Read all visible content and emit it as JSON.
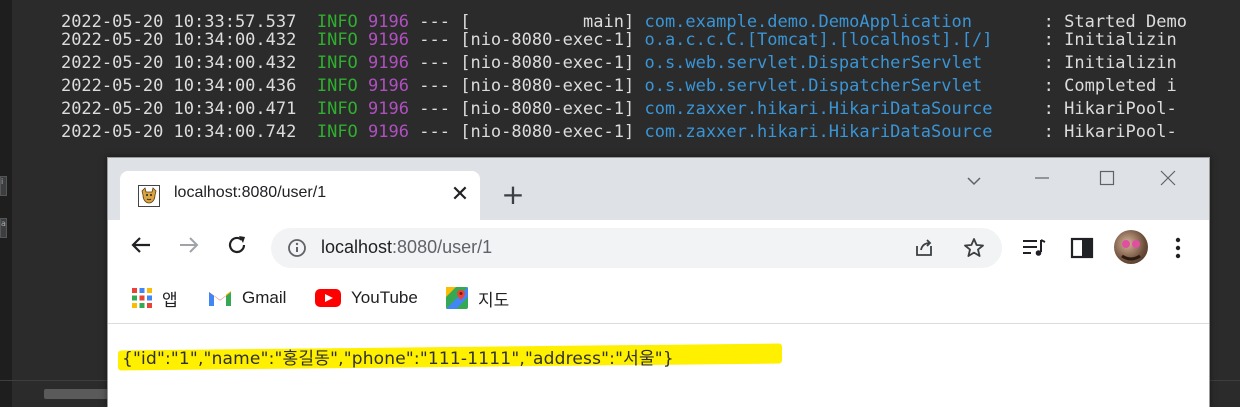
{
  "console": {
    "lines": [
      {
        "timestamp": "2022-05-20 10:33:57.537",
        "level": "INFO",
        "pid": "9196",
        "sep": "---",
        "thread": "[           main]",
        "logger": "com.example.demo.DemoApplication",
        "message": ": Started Demo"
      },
      {
        "timestamp": "2022-05-20 10:34:00.432",
        "level": "INFO",
        "pid": "9196",
        "sep": "---",
        "thread": "[nio-8080-exec-1]",
        "logger": "o.a.c.c.C.[Tomcat].[localhost].[/]",
        "message": ": Initializin"
      },
      {
        "timestamp": "2022-05-20 10:34:00.432",
        "level": "INFO",
        "pid": "9196",
        "sep": "---",
        "thread": "[nio-8080-exec-1]",
        "logger": "o.s.web.servlet.DispatcherServlet",
        "message": ": Initializin"
      },
      {
        "timestamp": "2022-05-20 10:34:00.436",
        "level": "INFO",
        "pid": "9196",
        "sep": "---",
        "thread": "[nio-8080-exec-1]",
        "logger": "o.s.web.servlet.DispatcherServlet",
        "message": ": Completed i"
      },
      {
        "timestamp": "2022-05-20 10:34:00.471",
        "level": "INFO",
        "pid": "9196",
        "sep": "---",
        "thread": "[nio-8080-exec-1]",
        "logger": "com.zaxxer.hikari.HikariDataSource",
        "message": ": HikariPool-"
      },
      {
        "timestamp": "2022-05-20 10:34:00.742",
        "level": "INFO",
        "pid": "9196",
        "sep": "---",
        "thread": "[nio-8080-exec-1]",
        "logger": "com.zaxxer.hikari.HikariDataSource",
        "message": ": HikariPool-"
      }
    ],
    "gutter_labels": [
      "i",
      "a"
    ],
    "colors": {
      "background": "#2b2b2b",
      "level": "#2fae2f",
      "pid": "#b04fc0",
      "logger": "#3a95d6",
      "text": "#dcdcdc"
    }
  },
  "browser": {
    "tab": {
      "title": "localhost:8080/user/1",
      "close": "✕",
      "favicon": "tomcat-icon"
    },
    "new_tab": "+",
    "window_controls": {
      "dropdown": "⌄",
      "minimize": "—",
      "maximize": "☐",
      "close": "✕"
    },
    "nav": {
      "back": "←",
      "forward": "→",
      "reload": "↻"
    },
    "address": {
      "host": "localhost",
      "path": ":8080/user/1"
    },
    "bookmarks": [
      {
        "label": "앱",
        "icon": "apps-grid-icon"
      },
      {
        "label": "Gmail",
        "icon": "gmail-icon"
      },
      {
        "label": "YouTube",
        "icon": "youtube-icon"
      },
      {
        "label": "지도",
        "icon": "maps-icon"
      }
    ],
    "body_text": "{\"id\":\"1\",\"name\":\"홍길동\",\"phone\":\"111-1111\",\"address\":\"서울\"}",
    "highlight_color": "#fff000"
  }
}
